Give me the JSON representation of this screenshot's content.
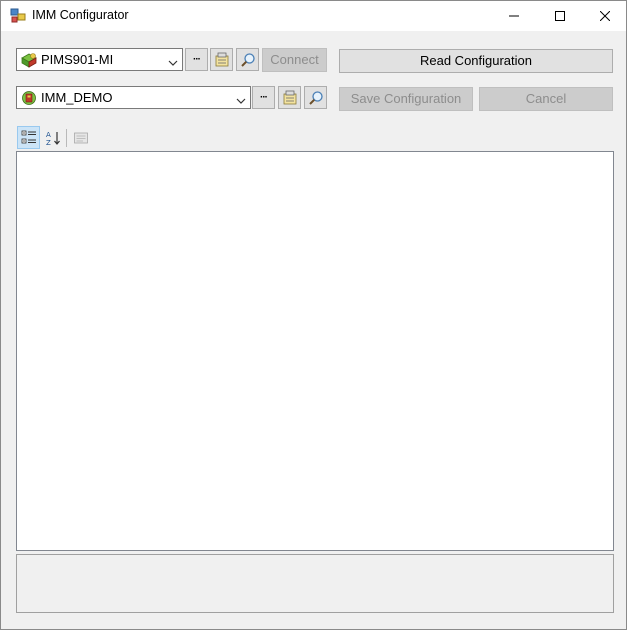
{
  "window": {
    "title": "IMM Configurator",
    "icon": "app-window-icon"
  },
  "server_row": {
    "combo_value": "PIMS901-MI",
    "combo_icon": "server-icon",
    "browse_label": "···",
    "connect_label": "Connect",
    "read_config_label": "Read Configuration"
  },
  "config_row": {
    "combo_value": "IMM_DEMO",
    "combo_icon": "imm-config-icon",
    "browse_label": "···",
    "save_config_label": "Save Configuration",
    "cancel_label": "Cancel"
  },
  "toolbar": {
    "categorized_icon": "categorized-view-icon",
    "alphabetical_icon": "alphabetical-sort-icon",
    "property_pages_icon": "property-pages-icon"
  },
  "colors": {
    "disabled_bg": "#cccccc",
    "disabled_text": "#8d8d8d",
    "button_bg": "#e1e1e1",
    "checked_bg": "#cce4f7"
  }
}
